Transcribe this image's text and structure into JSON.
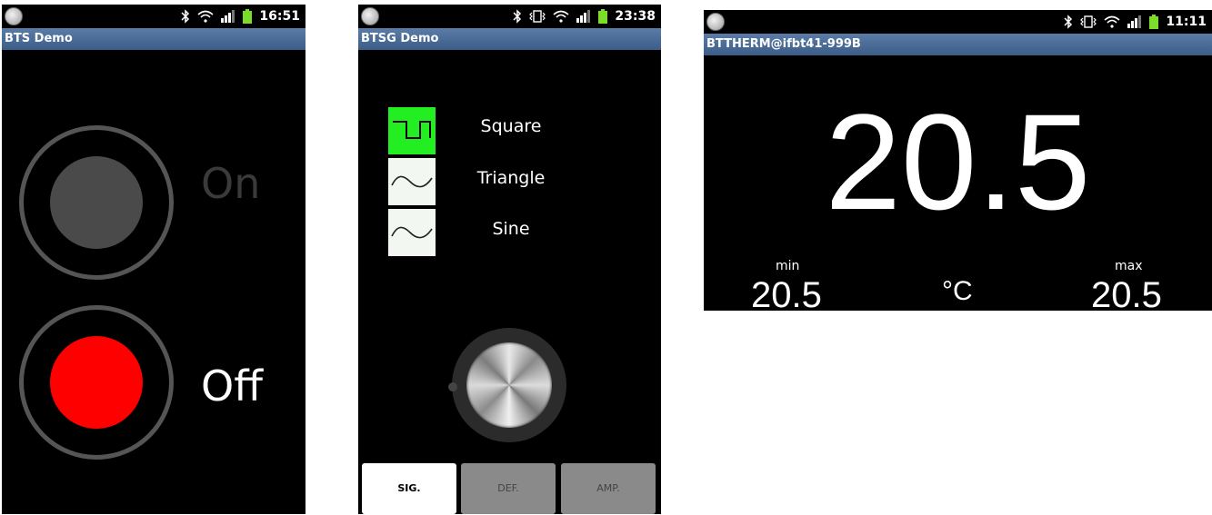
{
  "screens": [
    {
      "status": {
        "time": "16:51"
      },
      "title": "BTS Demo",
      "toggles": [
        {
          "label": "On",
          "dot_color": "#4a4a4a",
          "label_color": "#3a3a3a"
        },
        {
          "label": "Off",
          "dot_color": "#ff0000",
          "label_color": "#ffffff"
        }
      ]
    },
    {
      "status": {
        "time": "23:38"
      },
      "title": "BTSG Demo",
      "waveforms": [
        {
          "label": "Square",
          "icon": "square-wave-icon",
          "selected": true
        },
        {
          "label": "Triangle",
          "icon": "wave-icon",
          "selected": false
        },
        {
          "label": "Sine",
          "icon": "wave-icon",
          "selected": false
        }
      ],
      "knob": {
        "icon": "knob-icon"
      },
      "tabs": [
        {
          "label": "SIG.",
          "active": true
        },
        {
          "label": "DEF.",
          "active": false
        },
        {
          "label": "AMP.",
          "active": false
        }
      ]
    },
    {
      "status": {
        "time": "11:11"
      },
      "title": "BTTHERM@ifbt41-999B",
      "temperature": "20.5",
      "min_label": "min",
      "min_value": "20.5",
      "unit": "°C",
      "max_label": "max",
      "max_value": "20.5"
    }
  ],
  "colors": {
    "accent_green": "#22ee22",
    "titlebar": "#46688f",
    "active_red": "#ff0000"
  }
}
